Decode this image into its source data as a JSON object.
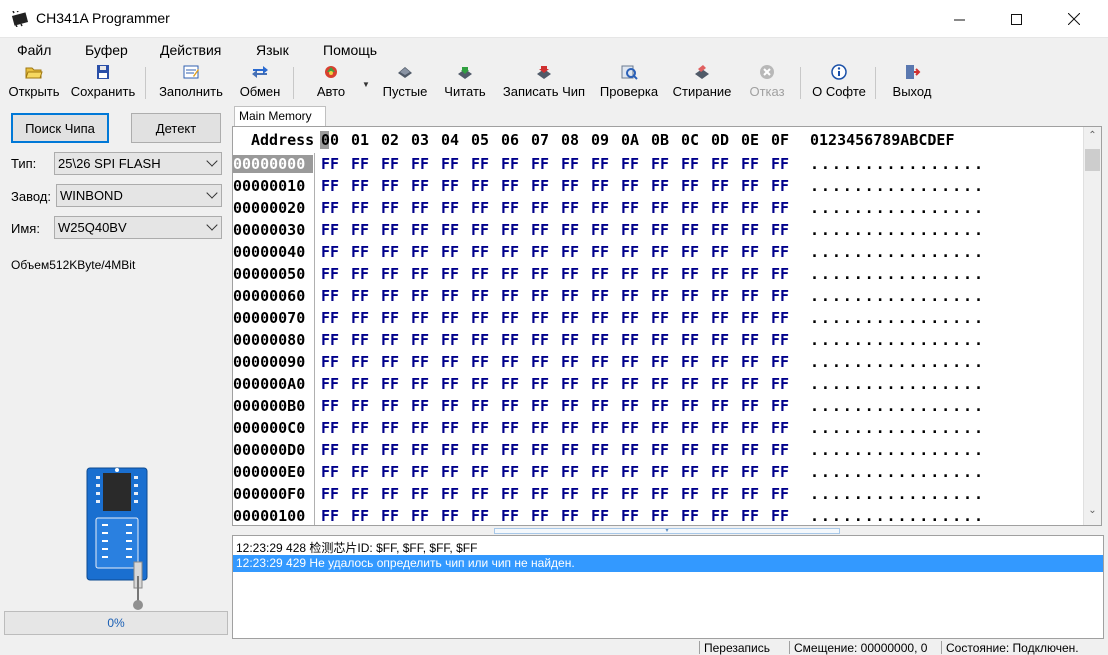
{
  "window": {
    "title": "CH341A Programmer",
    "icon": "chip-icon",
    "controls": [
      "minimize",
      "maximize",
      "close"
    ]
  },
  "menu": [
    "Файл",
    "Буфер",
    "Действия",
    "Язык",
    "Помощь"
  ],
  "toolbar": [
    {
      "label": "Открыть",
      "icon": "open-folder-icon",
      "enabled": true
    },
    {
      "label": "Сохранить",
      "icon": "floppy-save-icon",
      "enabled": true
    },
    {
      "label": "Заполнить",
      "icon": "fill-icon",
      "enabled": true
    },
    {
      "label": "Обмен",
      "icon": "swap-arrows-icon",
      "enabled": true
    },
    {
      "label": "Авто",
      "icon": "auto-icon",
      "enabled": true
    },
    {
      "label": "Пустые",
      "icon": "blank-check-icon",
      "enabled": true
    },
    {
      "label": "Читать",
      "icon": "read-icon",
      "enabled": true
    },
    {
      "label": "Записать Чип",
      "icon": "write-chip-icon",
      "enabled": true
    },
    {
      "label": "Проверка",
      "icon": "verify-icon",
      "enabled": true
    },
    {
      "label": "Стирание",
      "icon": "erase-icon",
      "enabled": true
    },
    {
      "label": "Отказ",
      "icon": "cancel-icon",
      "enabled": false
    },
    {
      "label": "О Софте",
      "icon": "info-icon",
      "enabled": true
    },
    {
      "label": "Выход",
      "icon": "exit-door-icon",
      "enabled": true
    }
  ],
  "left_panel": {
    "detect_chip_button": "Поиск Чипа",
    "detect_button": "Детект",
    "type_label": "Тип:",
    "type_value": "25\\26 SPI FLASH",
    "manufacturer_label": "Завод:",
    "manufacturer_value": "WINBOND",
    "name_label": "Имя:",
    "name_value": "W25Q40BV",
    "volume": "Объем512KByte/4MBit",
    "progress": "0%",
    "progress_value": 0
  },
  "hex_editor": {
    "tab": "Main Memory",
    "address_header": "Address",
    "columns": [
      "00",
      "01",
      "02",
      "03",
      "04",
      "05",
      "06",
      "07",
      "08",
      "09",
      "0A",
      "0B",
      "0C",
      "0D",
      "0E",
      "0F"
    ],
    "ascii_header": "0123456789ABCDEF",
    "rows": [
      {
        "address": "00000000",
        "bytes": [
          "FF",
          "FF",
          "FF",
          "FF",
          "FF",
          "FF",
          "FF",
          "FF",
          "FF",
          "FF",
          "FF",
          "FF",
          "FF",
          "FF",
          "FF",
          "FF"
        ],
        "ascii": "................"
      },
      {
        "address": "00000010",
        "bytes": [
          "FF",
          "FF",
          "FF",
          "FF",
          "FF",
          "FF",
          "FF",
          "FF",
          "FF",
          "FF",
          "FF",
          "FF",
          "FF",
          "FF",
          "FF",
          "FF"
        ],
        "ascii": "................"
      },
      {
        "address": "00000020",
        "bytes": [
          "FF",
          "FF",
          "FF",
          "FF",
          "FF",
          "FF",
          "FF",
          "FF",
          "FF",
          "FF",
          "FF",
          "FF",
          "FF",
          "FF",
          "FF",
          "FF"
        ],
        "ascii": "................"
      },
      {
        "address": "00000030",
        "bytes": [
          "FF",
          "FF",
          "FF",
          "FF",
          "FF",
          "FF",
          "FF",
          "FF",
          "FF",
          "FF",
          "FF",
          "FF",
          "FF",
          "FF",
          "FF",
          "FF"
        ],
        "ascii": "................"
      },
      {
        "address": "00000040",
        "bytes": [
          "FF",
          "FF",
          "FF",
          "FF",
          "FF",
          "FF",
          "FF",
          "FF",
          "FF",
          "FF",
          "FF",
          "FF",
          "FF",
          "FF",
          "FF",
          "FF"
        ],
        "ascii": "................"
      },
      {
        "address": "00000050",
        "bytes": [
          "FF",
          "FF",
          "FF",
          "FF",
          "FF",
          "FF",
          "FF",
          "FF",
          "FF",
          "FF",
          "FF",
          "FF",
          "FF",
          "FF",
          "FF",
          "FF"
        ],
        "ascii": "................"
      },
      {
        "address": "00000060",
        "bytes": [
          "FF",
          "FF",
          "FF",
          "FF",
          "FF",
          "FF",
          "FF",
          "FF",
          "FF",
          "FF",
          "FF",
          "FF",
          "FF",
          "FF",
          "FF",
          "FF"
        ],
        "ascii": "................"
      },
      {
        "address": "00000070",
        "bytes": [
          "FF",
          "FF",
          "FF",
          "FF",
          "FF",
          "FF",
          "FF",
          "FF",
          "FF",
          "FF",
          "FF",
          "FF",
          "FF",
          "FF",
          "FF",
          "FF"
        ],
        "ascii": "................"
      },
      {
        "address": "00000080",
        "bytes": [
          "FF",
          "FF",
          "FF",
          "FF",
          "FF",
          "FF",
          "FF",
          "FF",
          "FF",
          "FF",
          "FF",
          "FF",
          "FF",
          "FF",
          "FF",
          "FF"
        ],
        "ascii": "................"
      },
      {
        "address": "00000090",
        "bytes": [
          "FF",
          "FF",
          "FF",
          "FF",
          "FF",
          "FF",
          "FF",
          "FF",
          "FF",
          "FF",
          "FF",
          "FF",
          "FF",
          "FF",
          "FF",
          "FF"
        ],
        "ascii": "................"
      },
      {
        "address": "000000A0",
        "bytes": [
          "FF",
          "FF",
          "FF",
          "FF",
          "FF",
          "FF",
          "FF",
          "FF",
          "FF",
          "FF",
          "FF",
          "FF",
          "FF",
          "FF",
          "FF",
          "FF"
        ],
        "ascii": "................"
      },
      {
        "address": "000000B0",
        "bytes": [
          "FF",
          "FF",
          "FF",
          "FF",
          "FF",
          "FF",
          "FF",
          "FF",
          "FF",
          "FF",
          "FF",
          "FF",
          "FF",
          "FF",
          "FF",
          "FF"
        ],
        "ascii": "................"
      },
      {
        "address": "000000C0",
        "bytes": [
          "FF",
          "FF",
          "FF",
          "FF",
          "FF",
          "FF",
          "FF",
          "FF",
          "FF",
          "FF",
          "FF",
          "FF",
          "FF",
          "FF",
          "FF",
          "FF"
        ],
        "ascii": "................"
      },
      {
        "address": "000000D0",
        "bytes": [
          "FF",
          "FF",
          "FF",
          "FF",
          "FF",
          "FF",
          "FF",
          "FF",
          "FF",
          "FF",
          "FF",
          "FF",
          "FF",
          "FF",
          "FF",
          "FF"
        ],
        "ascii": "................"
      },
      {
        "address": "000000E0",
        "bytes": [
          "FF",
          "FF",
          "FF",
          "FF",
          "FF",
          "FF",
          "FF",
          "FF",
          "FF",
          "FF",
          "FF",
          "FF",
          "FF",
          "FF",
          "FF",
          "FF"
        ],
        "ascii": "................"
      },
      {
        "address": "000000F0",
        "bytes": [
          "FF",
          "FF",
          "FF",
          "FF",
          "FF",
          "FF",
          "FF",
          "FF",
          "FF",
          "FF",
          "FF",
          "FF",
          "FF",
          "FF",
          "FF",
          "FF"
        ],
        "ascii": "................"
      },
      {
        "address": "00000100",
        "bytes": [
          "FF",
          "FF",
          "FF",
          "FF",
          "FF",
          "FF",
          "FF",
          "FF",
          "FF",
          "FF",
          "FF",
          "FF",
          "FF",
          "FF",
          "FF",
          "FF"
        ],
        "ascii": "................"
      }
    ]
  },
  "log": [
    {
      "text": "12:23:29 428 检测芯片ID: $FF, $FF, $FF, $FF",
      "selected": false
    },
    {
      "text": "12:23:29 429 Не удалось определить чип или чип не найден.",
      "selected": true
    }
  ],
  "statusbar": {
    "mode": "Перезапись",
    "offset": "Смещение: 00000000, 0",
    "state": "Состояние: Подключен."
  },
  "colors": {
    "hex_bytes": "#00008b",
    "selection": "#3399ff",
    "chip_board": "#1a6fd0"
  }
}
